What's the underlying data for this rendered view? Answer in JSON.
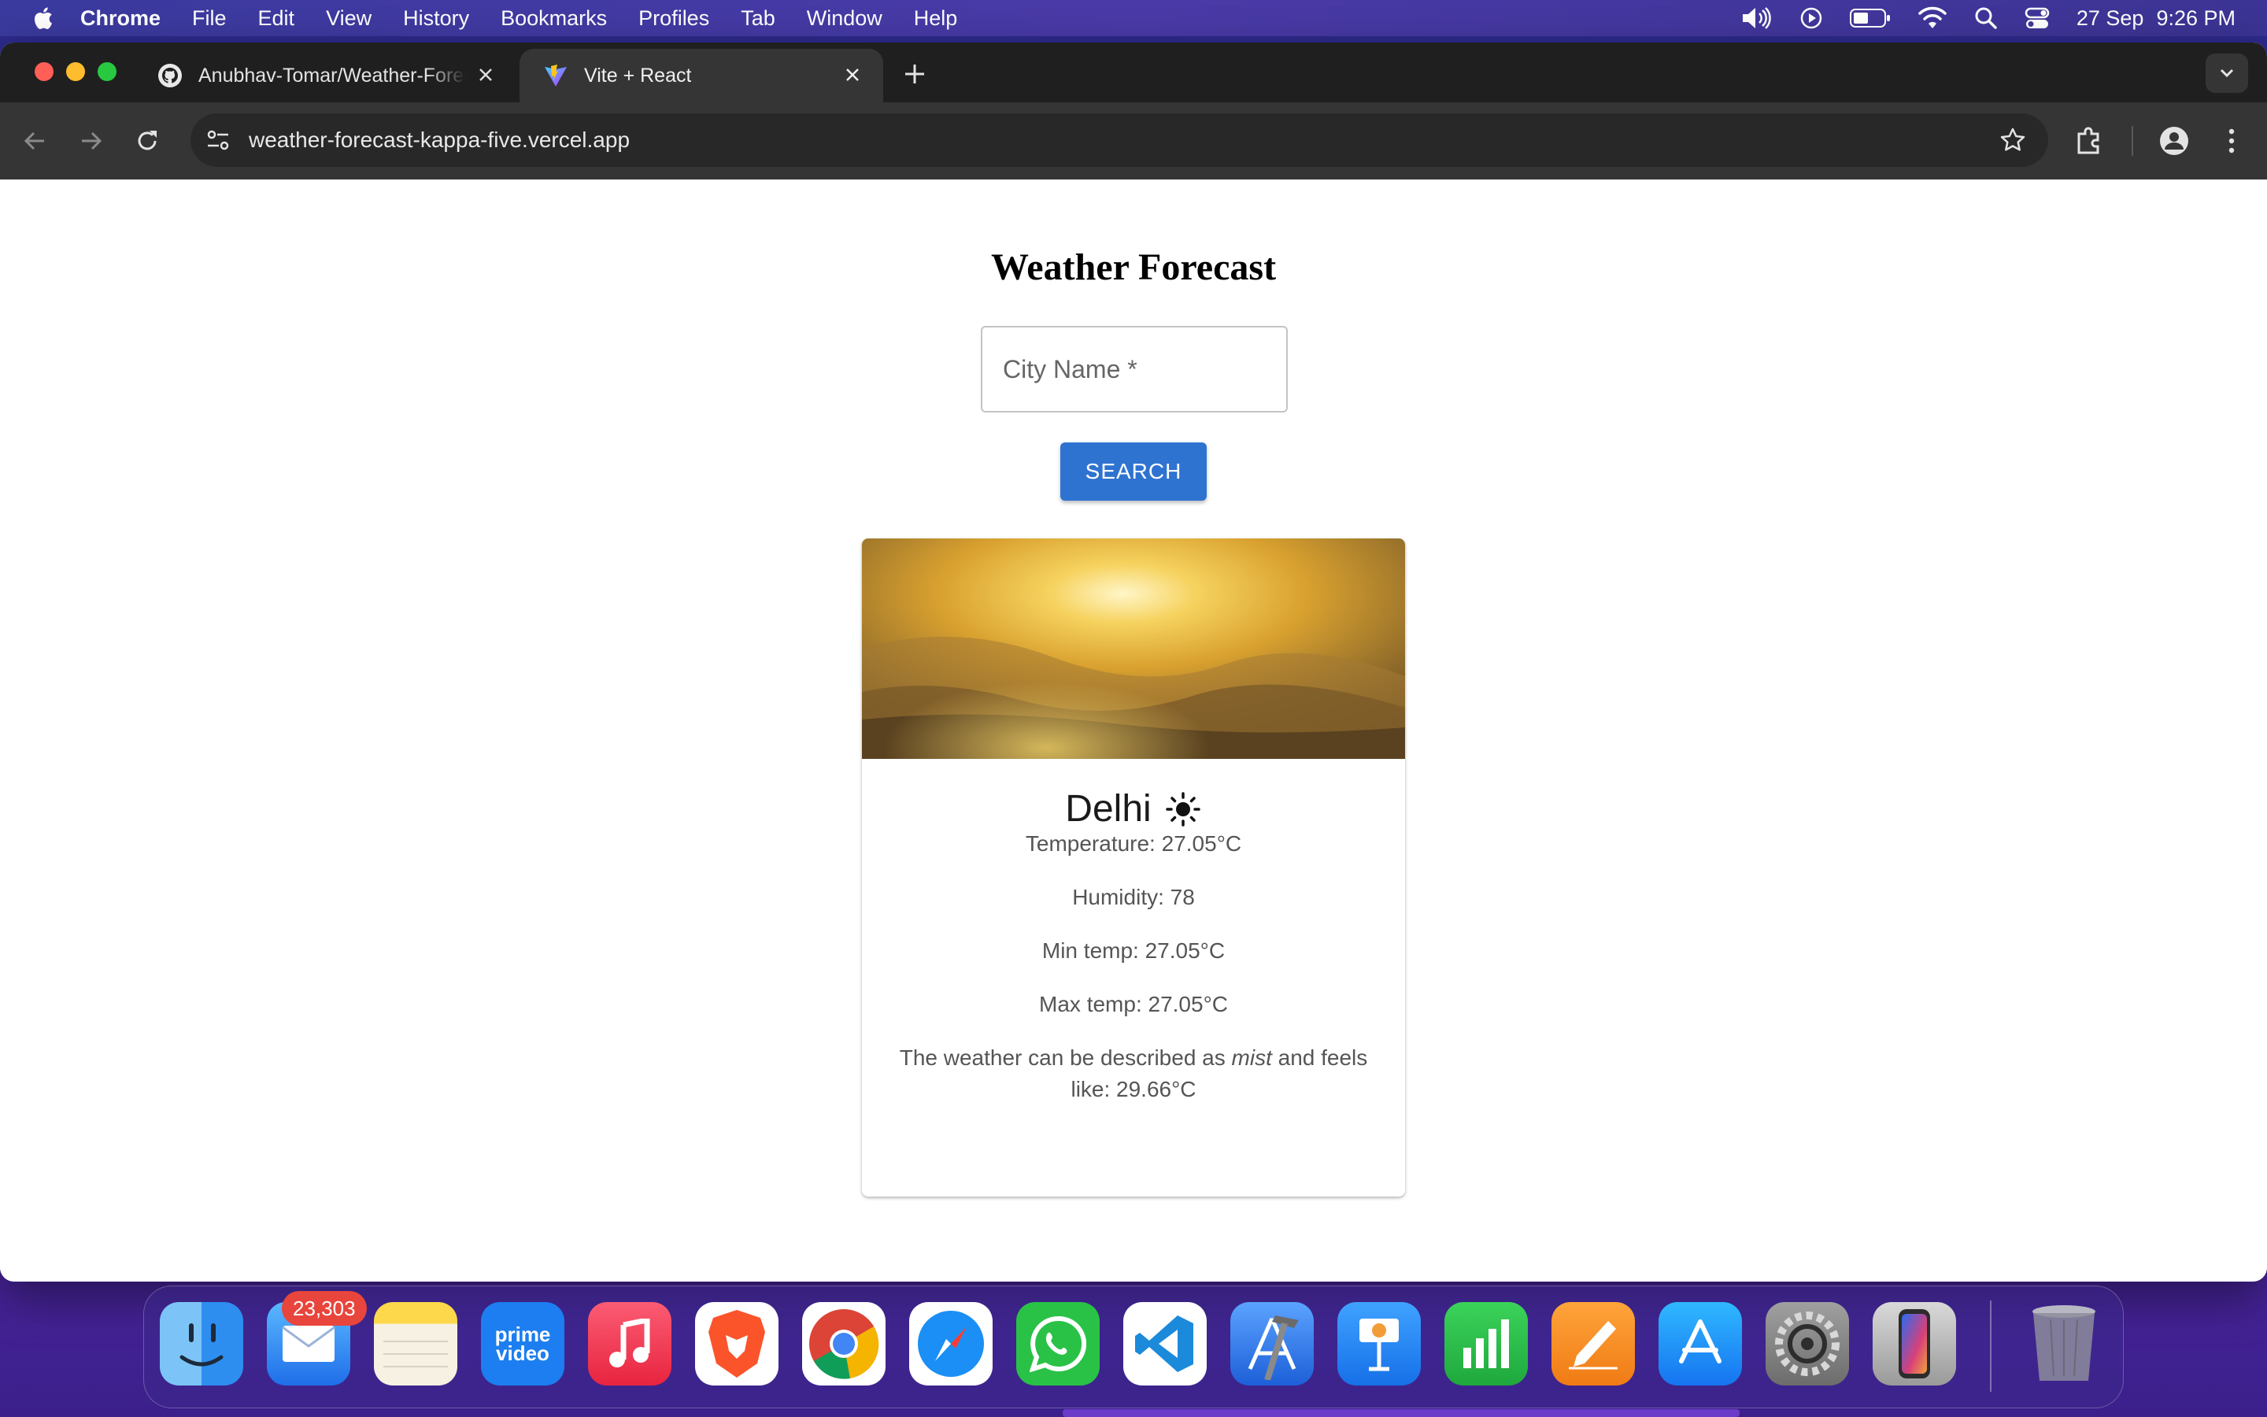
{
  "menubar": {
    "app": "Chrome",
    "items": [
      "File",
      "Edit",
      "View",
      "History",
      "Bookmarks",
      "Profiles",
      "Tab",
      "Window",
      "Help"
    ],
    "date": "27 Sep",
    "time": "9:26 PM"
  },
  "browser": {
    "tabs": [
      {
        "title": "Anubhav-Tomar/Weather-Forecast",
        "icon": "github-icon"
      },
      {
        "title": "Vite + React",
        "icon": "vite-icon",
        "active": true
      }
    ],
    "url": "weather-forecast-kappa-five.vercel.app"
  },
  "page": {
    "heading": "Weather Forecast",
    "city_placeholder": "City Name *",
    "search_label": "SEARCH",
    "card": {
      "city": "Delhi",
      "weather_icon": "sun-icon",
      "temperature": "Temperature: 27.05°C",
      "humidity": "Humidity: 78",
      "min_temp": "Min temp: 27.05°C",
      "max_temp": "Max temp: 27.05°C",
      "description_prefix": "The weather can be described as",
      "description_word": "mist",
      "description_suffix": "and feels like: 29.66°C"
    }
  },
  "dock": {
    "mail_badge": "23,303",
    "apps": [
      "Finder",
      "Mail",
      "Notes",
      "Prime Video",
      "Music",
      "Brave",
      "Chrome",
      "Safari",
      "WhatsApp",
      "VS Code",
      "Xcode",
      "Keynote",
      "Numbers",
      "Pages",
      "App Store",
      "System Settings",
      "iPhone Mirroring",
      "Trash"
    ],
    "prime_video_label_1": "prime",
    "prime_video_label_2": "video"
  },
  "colors": {
    "search_button": "#2f73d1",
    "tab_bar": "#1f1f1f",
    "toolbar": "#353535"
  }
}
